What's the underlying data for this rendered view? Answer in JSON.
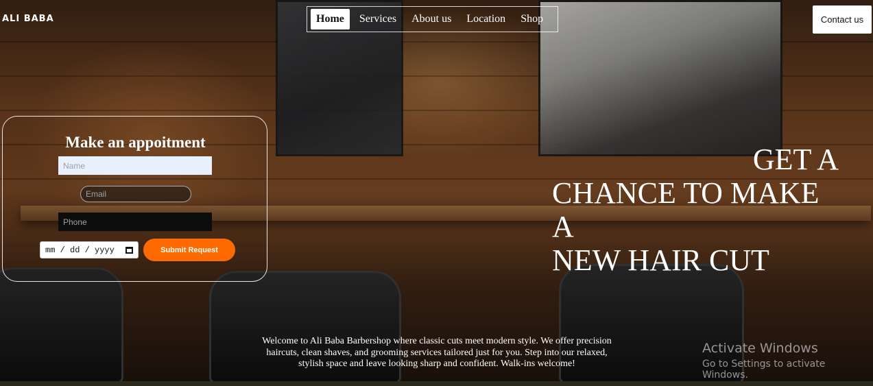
{
  "brand": {
    "name": "ALI BABA"
  },
  "nav": {
    "items": [
      {
        "label": "Home",
        "active": true
      },
      {
        "label": "Services",
        "active": false
      },
      {
        "label": "About us",
        "active": false
      },
      {
        "label": "Location",
        "active": false
      },
      {
        "label": "Shop",
        "active": false
      }
    ]
  },
  "header": {
    "contact_label": "Contact us"
  },
  "appointment": {
    "title": "Make an appoitment",
    "name_placeholder": "Name",
    "email_placeholder": "Email",
    "phone_placeholder": "Phone",
    "date_placeholder": "mm / dd / yyyy",
    "submit_label": "Submit Request",
    "submit_color": "#ff6a00"
  },
  "hero": {
    "line1": "GET A",
    "line2": "CHANCE TO MAKE A",
    "line3": "NEW HAIR CUT"
  },
  "welcome": {
    "text": "Welcome to Ali Baba Barbershop where classic cuts meet modern style. We offer precision haircuts, clean shaves, and grooming services tailored just for you. Step into our relaxed, stylish space and leave looking sharp and confident. Walk-ins welcome!"
  },
  "watermark": {
    "title": "Activate Windows",
    "subtitle": "Go to Settings to activate Windows."
  },
  "icons": {
    "date_picker": "calendar-icon"
  }
}
